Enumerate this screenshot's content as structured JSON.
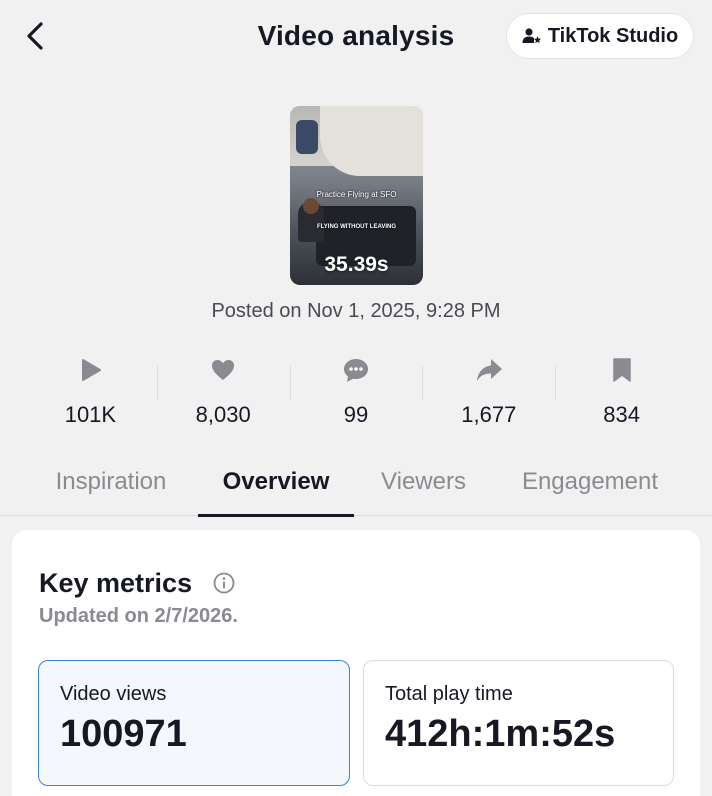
{
  "header": {
    "title": "Video analysis",
    "studio_label": "TikTok Studio"
  },
  "video": {
    "caption_top": "Practice Flying at SFO",
    "caption_bottom": "FLYING WITHOUT LEAVING",
    "duration": "35.39s",
    "posted": "Posted on Nov 1, 2025, 9:28 PM"
  },
  "stats": [
    {
      "icon": "play-icon",
      "value": "101K"
    },
    {
      "icon": "heart-icon",
      "value": "8,030"
    },
    {
      "icon": "comment-icon",
      "value": "99"
    },
    {
      "icon": "share-icon",
      "value": "1,677"
    },
    {
      "icon": "bookmark-icon",
      "value": "834"
    }
  ],
  "tabs": [
    {
      "label": "Inspiration",
      "active": false
    },
    {
      "label": "Overview",
      "active": true
    },
    {
      "label": "Viewers",
      "active": false
    },
    {
      "label": "Engagement",
      "active": false
    }
  ],
  "key_metrics": {
    "title": "Key metrics",
    "updated": "Updated on 2/7/2026.",
    "cards": [
      {
        "label": "Video views",
        "value": "100971",
        "selected": true
      },
      {
        "label": "Total play time",
        "value": "412h:1m:52s",
        "selected": false
      }
    ]
  },
  "colors": {
    "accent_border": "#3b82d9",
    "text_primary": "#161823",
    "text_secondary": "#8a8b91"
  }
}
